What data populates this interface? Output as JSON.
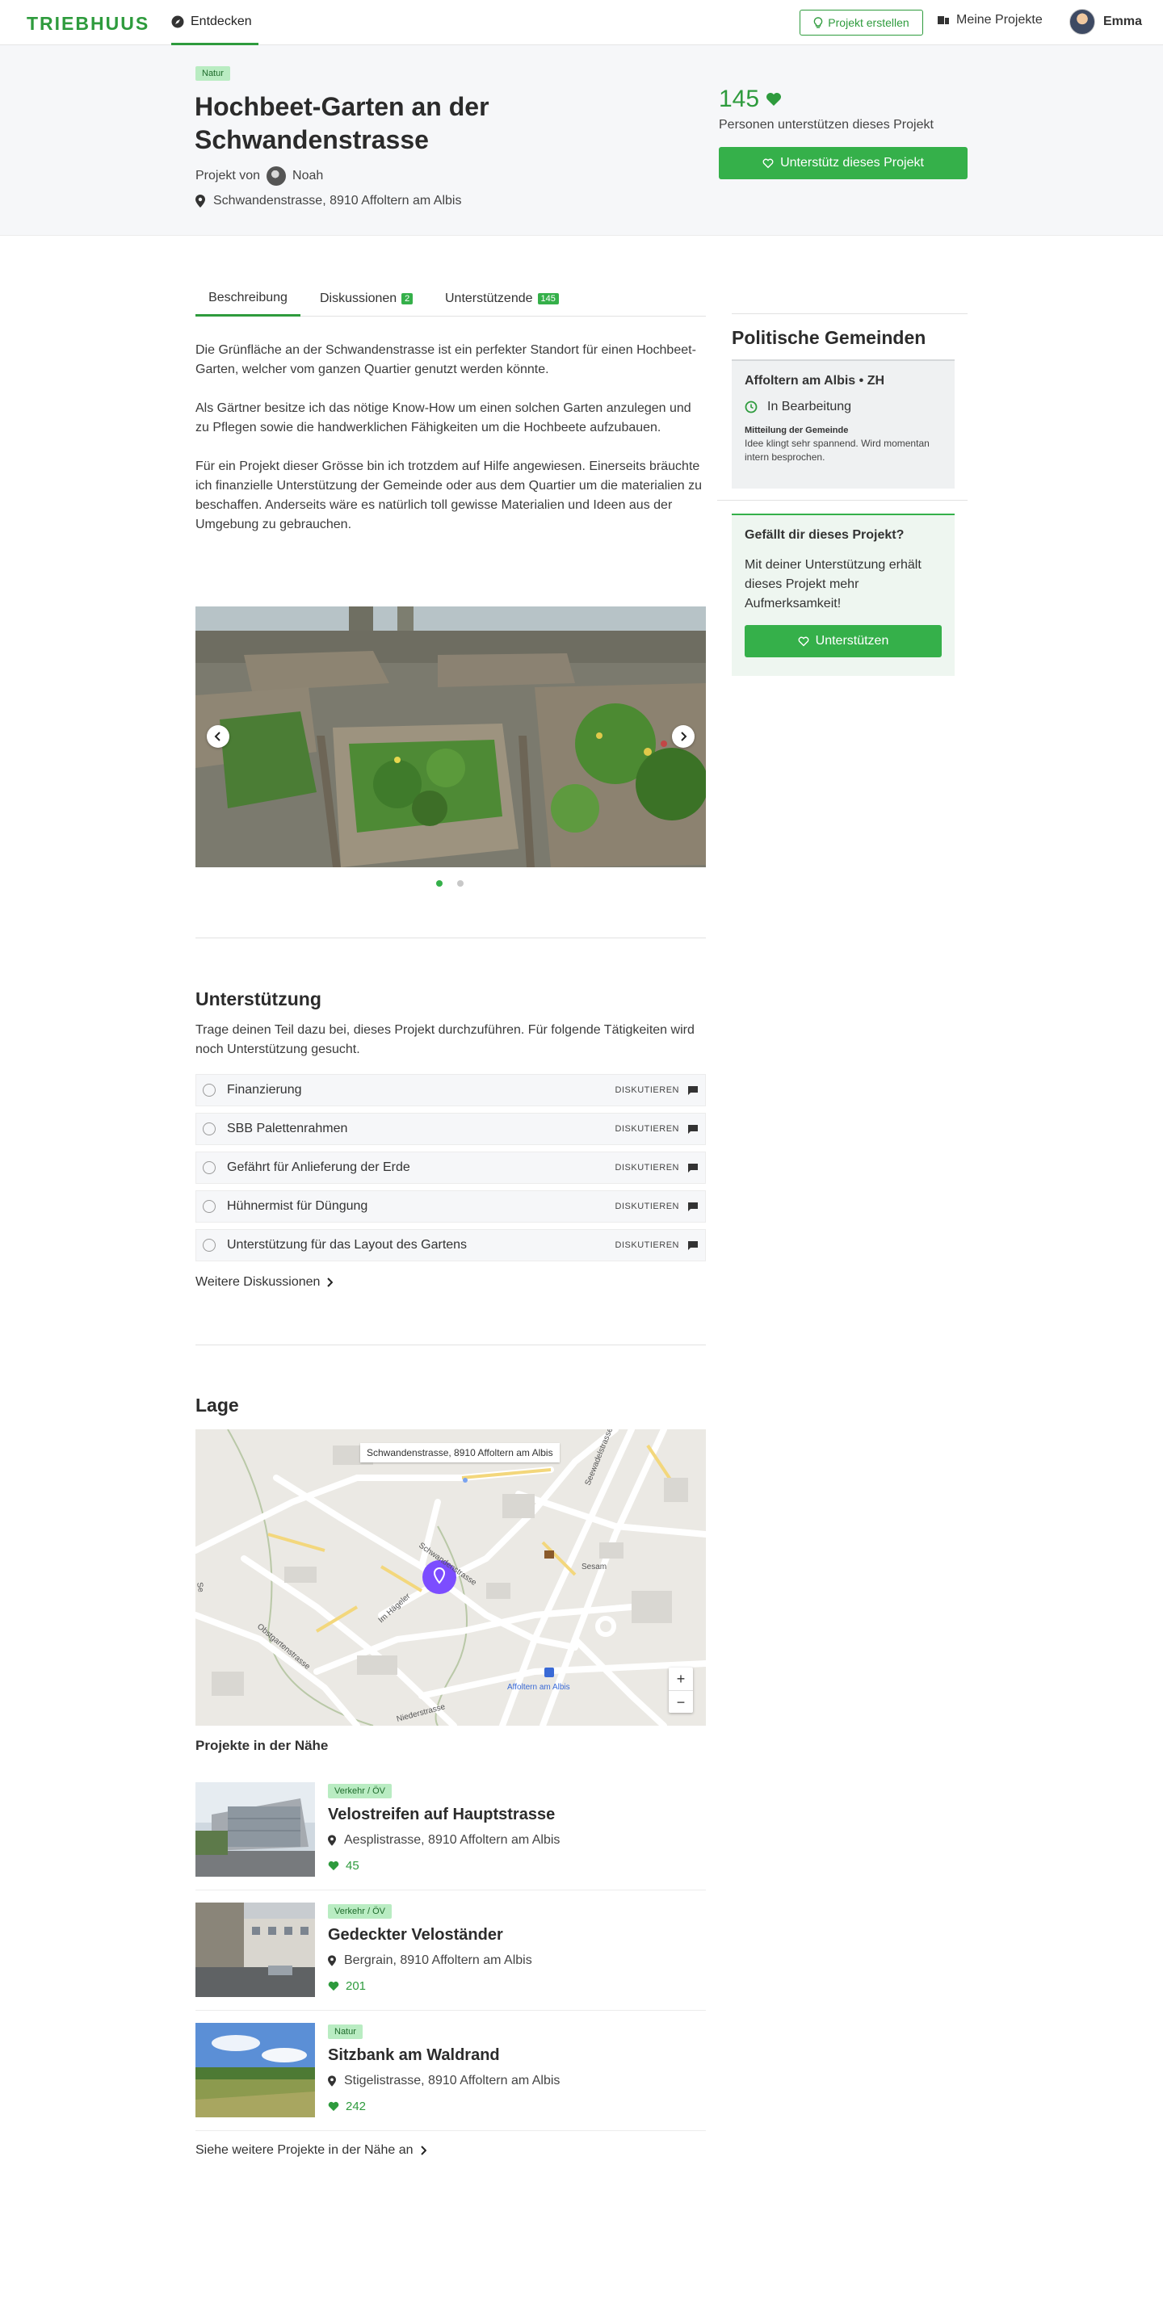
{
  "nav": {
    "logo": "TRIEBHUUS",
    "discover": "Entdecken",
    "create": "Projekt erstellen",
    "my_projects": "Meine Projekte",
    "user": "Emma"
  },
  "project": {
    "tag": "Natur",
    "title": "Hochbeet-Garten an der Schwandenstrasse",
    "by_label": "Projekt von",
    "author": "Noah",
    "address": "Schwandenstrasse, 8910 Affoltern am Albis",
    "supporters_count": "145",
    "supporters_label": "Personen unterstützen dieses Projekt",
    "support_button": "Unterstütz dieses Projekt"
  },
  "tabs": [
    {
      "label": "Beschreibung"
    },
    {
      "label": "Diskussionen",
      "badge": "2"
    },
    {
      "label": "Unterstützende",
      "badge": "145"
    }
  ],
  "description": [
    "Die Grünfläche an der Schwandenstrasse ist ein perfekter Standort für einen Hochbeet-Garten, welcher vom ganzen Quartier genutzt werden könnte.",
    "Als Gärtner besitze ich das nötige Know-How um einen solchen Garten anzulegen und zu Pflegen sowie die handwerklichen Fähigkeiten um die Hochbeete aufzubauen.",
    "Für ein Projekt dieser Grösse bin ich trotzdem auf Hilfe angewiesen. Einerseits bräuchte ich finanzielle Unterstützung der Gemeinde oder aus dem Quartier um die materialien zu beschaffen. Anderseits wäre es natürlich toll gewisse Materialien und Ideen aus der Umgebung zu gebrauchen."
  ],
  "carousel": {
    "slides": 2,
    "active": 1
  },
  "sidebar": {
    "title": "Politische Gemeinden",
    "municipality": "Affoltern am Albis • ZH",
    "status": "In Bearbeitung",
    "message_label": "Mitteilung der Gemeinde",
    "message": "Idee klingt sehr spannend. Wird momentan intern besprochen.",
    "like_title": "Gefällt dir dieses Projekt?",
    "like_text": "Mit deiner Unterstützung erhält dieses Projekt mehr Aufmerksamkeit!",
    "like_button": "Unterstützen"
  },
  "support": {
    "title": "Unterstützung",
    "intro": "Trage deinen Teil dazu bei, dieses Projekt durchzuführen. Für folgende Tätigkeiten wird noch Unterstützung gesucht.",
    "discuss_label": "DISKUTIEREN",
    "tasks": [
      {
        "label": "Finanzierung"
      },
      {
        "label": "SBB Palettenrahmen"
      },
      {
        "label": "Gefährt für Anlieferung der Erde"
      },
      {
        "label": "Hühnermist für Düngung"
      },
      {
        "label": "Unterstützung für das Layout des Gartens"
      }
    ],
    "more": "Weitere Diskussionen"
  },
  "location": {
    "title": "Lage",
    "map_address": "Schwandenstrasse, 8910 Affoltern am Albis",
    "street_labels": {
      "s1": "Schwandenstrasse",
      "s2": "Seewadelstrasse",
      "s3": "Im Hägeler",
      "s4": "Obstgartenstrasse",
      "s5": "Niederstrasse",
      "poi1": "Sesam",
      "poi2": "Affoltern am Albis",
      "s6": "Se"
    },
    "zoom_in": "+",
    "zoom_out": "−"
  },
  "nearby": {
    "title": "Projekte in der Nähe",
    "items": [
      {
        "tag": "Verkehr / ÖV",
        "title": "Velostreifen auf Hauptstrasse",
        "address": "Aesplistrasse, 8910 Affoltern am Albis",
        "count": "45"
      },
      {
        "tag": "Verkehr / ÖV",
        "title": "Gedeckter Veloständer",
        "address": "Bergrain, 8910 Affoltern am Albis",
        "count": "201"
      },
      {
        "tag": "Natur",
        "title": "Sitzbank am Waldrand",
        "address": "Stigelistrasse, 8910 Affoltern am Albis",
        "count": "242"
      }
    ],
    "more": "Siehe weitere Projekte in der Nähe an"
  },
  "colors": {
    "brand": "#2e9b3d",
    "button": "#35b04a",
    "tag_bg": "#b9ecc2",
    "map_pin": "#7c4dff"
  }
}
